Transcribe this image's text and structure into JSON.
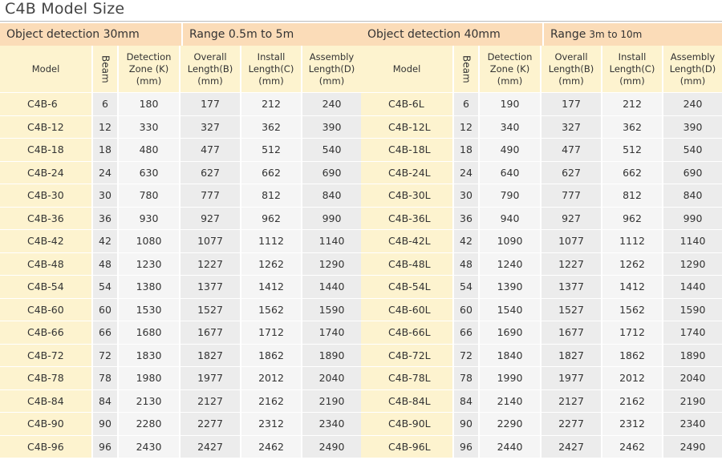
{
  "title": "C4B Model Size",
  "left": {
    "band": {
      "label1": "Object detection 30mm",
      "label2": "Range 0.5m to 5m",
      "label2_small": ""
    },
    "headers": [
      "Model",
      "Beam",
      "Detection\nZone (K)\n(mm)",
      "Overall\nLength(B)\n(mm)",
      "Install\nLength(C)\n(mm)",
      "Assembly\nLength(D)\n(mm)"
    ],
    "rows": [
      [
        "C4B-6",
        "6",
        "180",
        "177",
        "212",
        "240"
      ],
      [
        "C4B-12",
        "12",
        "330",
        "327",
        "362",
        "390"
      ],
      [
        "C4B-18",
        "18",
        "480",
        "477",
        "512",
        "540"
      ],
      [
        "C4B-24",
        "24",
        "630",
        "627",
        "662",
        "690"
      ],
      [
        "C4B-30",
        "30",
        "780",
        "777",
        "812",
        "840"
      ],
      [
        "C4B-36",
        "36",
        "930",
        "927",
        "962",
        "990"
      ],
      [
        "C4B-42",
        "42",
        "1080",
        "1077",
        "1112",
        "1140"
      ],
      [
        "C4B-48",
        "48",
        "1230",
        "1227",
        "1262",
        "1290"
      ],
      [
        "C4B-54",
        "54",
        "1380",
        "1377",
        "1412",
        "1440"
      ],
      [
        "C4B-60",
        "60",
        "1530",
        "1527",
        "1562",
        "1590"
      ],
      [
        "C4B-66",
        "66",
        "1680",
        "1677",
        "1712",
        "1740"
      ],
      [
        "C4B-72",
        "72",
        "1830",
        "1827",
        "1862",
        "1890"
      ],
      [
        "C4B-78",
        "78",
        "1980",
        "1977",
        "2012",
        "2040"
      ],
      [
        "C4B-84",
        "84",
        "2130",
        "2127",
        "2162",
        "2190"
      ],
      [
        "C4B-90",
        "90",
        "2280",
        "2277",
        "2312",
        "2340"
      ],
      [
        "C4B-96",
        "96",
        "2430",
        "2427",
        "2462",
        "2490"
      ]
    ]
  },
  "right": {
    "band": {
      "label1": "Object detection 40mm",
      "label2": "Range",
      "label2_small": "3m to 10m"
    },
    "headers": [
      "Model",
      "Beam",
      "Detection\nZone (K)\n(mm)",
      "Overall\nLength(B)\n(mm)",
      "Install\nLength(C)\n(mm)",
      "Assembly\nLength(D)\n(mm)"
    ],
    "rows": [
      [
        "C4B-6L",
        "6",
        "190",
        "177",
        "212",
        "240"
      ],
      [
        "C4B-12L",
        "12",
        "340",
        "327",
        "362",
        "390"
      ],
      [
        "C4B-18L",
        "18",
        "490",
        "477",
        "512",
        "540"
      ],
      [
        "C4B-24L",
        "24",
        "640",
        "627",
        "662",
        "690"
      ],
      [
        "C4B-30L",
        "30",
        "790",
        "777",
        "812",
        "840"
      ],
      [
        "C4B-36L",
        "36",
        "940",
        "927",
        "962",
        "990"
      ],
      [
        "C4B-42L",
        "42",
        "1090",
        "1077",
        "1112",
        "1140"
      ],
      [
        "C4B-48L",
        "48",
        "1240",
        "1227",
        "1262",
        "1290"
      ],
      [
        "C4B-54L",
        "54",
        "1390",
        "1377",
        "1412",
        "1440"
      ],
      [
        "C4B-60L",
        "60",
        "1540",
        "1527",
        "1562",
        "1590"
      ],
      [
        "C4B-66L",
        "66",
        "1690",
        "1677",
        "1712",
        "1740"
      ],
      [
        "C4B-72L",
        "72",
        "1840",
        "1827",
        "1862",
        "1890"
      ],
      [
        "C4B-78L",
        "78",
        "1990",
        "1977",
        "2012",
        "2040"
      ],
      [
        "C4B-84L",
        "84",
        "2140",
        "2127",
        "2162",
        "2190"
      ],
      [
        "C4B-90L",
        "90",
        "2290",
        "2277",
        "2312",
        "2340"
      ],
      [
        "C4B-96L",
        "96",
        "2440",
        "2427",
        "2462",
        "2490"
      ]
    ]
  }
}
